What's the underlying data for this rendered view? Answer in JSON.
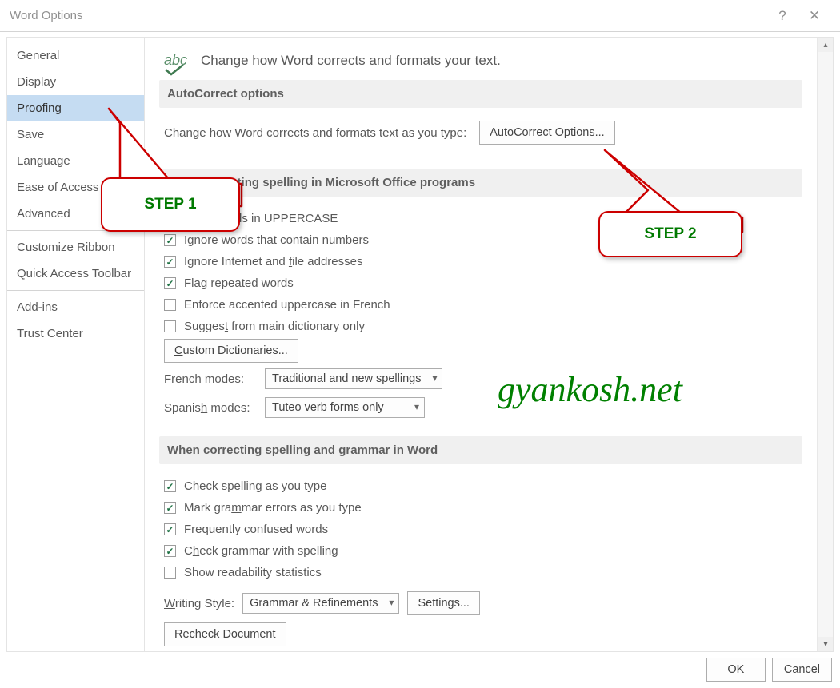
{
  "titlebar": {
    "title": "Word Options"
  },
  "sidebar": {
    "items": [
      {
        "label": "General"
      },
      {
        "label": "Display"
      },
      {
        "label": "Proofing"
      },
      {
        "label": "Save"
      },
      {
        "label": "Language"
      },
      {
        "label": "Ease of Access"
      },
      {
        "label": "Advanced"
      },
      {
        "label": "Customize Ribbon"
      },
      {
        "label": "Quick Access Toolbar"
      },
      {
        "label": "Add-ins"
      },
      {
        "label": "Trust Center"
      }
    ]
  },
  "header": {
    "text": "Change how Word corrects and formats your text."
  },
  "section1": {
    "title": "AutoCorrect options",
    "line": "Change how Word corrects and formats text as you type:",
    "button": "AutoCorrect Options..."
  },
  "section2": {
    "title": "en correcting spelling in Microsoft Office programs",
    "cbs": [
      {
        "label_suffix": "rds in UPPERCASE",
        "checked": true,
        "hidden_prefix": true
      },
      {
        "label": "Ignore words that contain numbers",
        "ul": "b",
        "checked": true
      },
      {
        "label": "Ignore Internet and file addresses",
        "ul": "f",
        "checked": true
      },
      {
        "label": "Flag repeated words",
        "ul": "r",
        "checked": true
      },
      {
        "label": "Enforce accented uppercase in French",
        "checked": false
      },
      {
        "label": "Suggest from main dictionary only",
        "ul": "t",
        "checked": false
      }
    ],
    "dict_button": "Custom Dictionaries...",
    "french_label": "French modes:",
    "french_value": "Traditional and new spellings",
    "spanish_label": "Spanish modes:",
    "spanish_value": "Tuteo verb forms only"
  },
  "section3": {
    "title": "When correcting spelling and grammar in Word",
    "cbs": [
      {
        "label": "Check spelling as you type",
        "ul": "p",
        "checked": true
      },
      {
        "label": "Mark grammar errors as you type",
        "ul": "m",
        "checked": true
      },
      {
        "label": "Frequently confused words",
        "checked": true
      },
      {
        "label": "Check grammar with spelling",
        "ul": "h",
        "checked": true
      },
      {
        "label": "Show readability statistics",
        "checked": false
      }
    ],
    "ws_label": "Writing Style:",
    "ws_value": "Grammar & Refinements",
    "settings_btn": "Settings...",
    "recheck_btn": "Recheck Document"
  },
  "callouts": {
    "step1": "STEP 1",
    "step2": "STEP 2"
  },
  "watermark": "gyankosh.net",
  "footer": {
    "ok": "OK",
    "cancel": "Cancel"
  }
}
